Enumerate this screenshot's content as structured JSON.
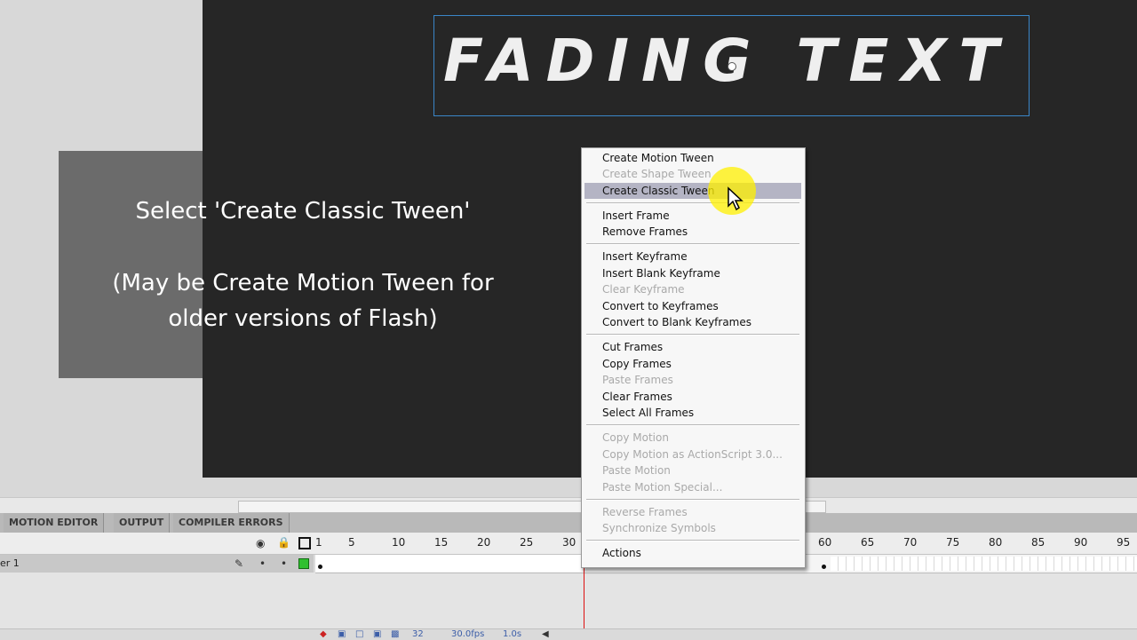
{
  "stage": {
    "title_text": "FADING TEXT"
  },
  "caption": {
    "line1": "Select 'Create Classic Tween'",
    "line2": "(May be Create Motion Tween for",
    "line3": "older versions of Flash)"
  },
  "panel_tabs": [
    "MOTION EDITOR",
    "OUTPUT",
    "COMPILER ERRORS"
  ],
  "timeline": {
    "layer_name": "er 1",
    "ruler_ticks": [
      "1",
      "5",
      "10",
      "15",
      "20",
      "25",
      "30",
      "60",
      "65",
      "70",
      "75",
      "80",
      "85",
      "90",
      "95"
    ],
    "current_frame": "32",
    "fps": "30.0fps",
    "time": "1.0s"
  },
  "context_menu": {
    "items": [
      {
        "label": "Create Motion Tween",
        "enabled": true
      },
      {
        "label": "Create Shape Tween",
        "enabled": false
      },
      {
        "label": "Create Classic Tween",
        "enabled": true,
        "highlighted": true
      },
      {
        "label": "Insert Frame",
        "enabled": true
      },
      {
        "label": "Remove Frames",
        "enabled": true
      },
      {
        "label": "Insert Keyframe",
        "enabled": true
      },
      {
        "label": "Insert Blank Keyframe",
        "enabled": true
      },
      {
        "label": "Clear Keyframe",
        "enabled": false
      },
      {
        "label": "Convert to Keyframes",
        "enabled": true
      },
      {
        "label": "Convert to Blank Keyframes",
        "enabled": true
      },
      {
        "label": "Cut Frames",
        "enabled": true
      },
      {
        "label": "Copy Frames",
        "enabled": true
      },
      {
        "label": "Paste Frames",
        "enabled": false
      },
      {
        "label": "Clear Frames",
        "enabled": true
      },
      {
        "label": "Select All Frames",
        "enabled": true
      },
      {
        "label": "Copy Motion",
        "enabled": false
      },
      {
        "label": "Copy Motion as ActionScript 3.0...",
        "enabled": false
      },
      {
        "label": "Paste Motion",
        "enabled": false
      },
      {
        "label": "Paste Motion Special...",
        "enabled": false
      },
      {
        "label": "Reverse Frames",
        "enabled": false
      },
      {
        "label": "Synchronize Symbols",
        "enabled": false
      },
      {
        "label": "Actions",
        "enabled": true
      }
    ]
  },
  "colors": {
    "stage_bg": "#262626",
    "selection_box": "#3a86c8",
    "menu_highlight": "#b4b4c4",
    "cursor_highlight": "#fff000",
    "playhead": "#dd1111"
  }
}
